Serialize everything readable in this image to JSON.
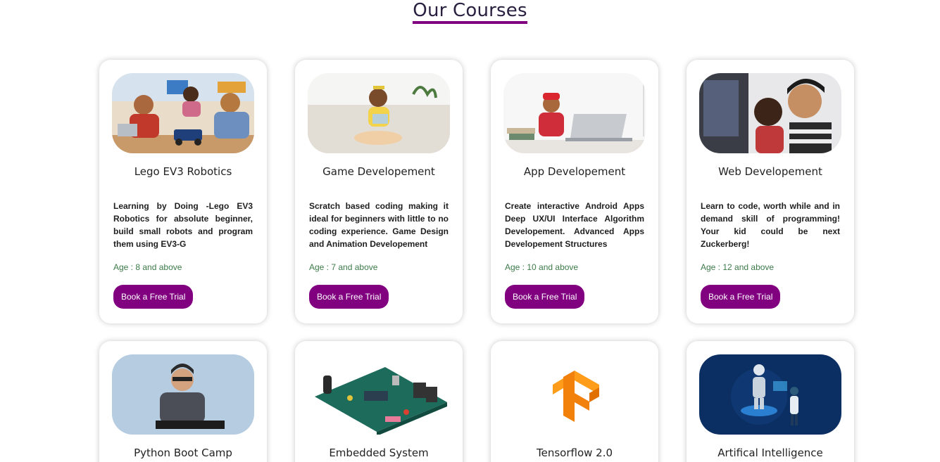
{
  "section_title": "Our Courses",
  "colors": {
    "accent": "#800080",
    "age_text": "#3d7a4a"
  },
  "courses": [
    {
      "title": "Lego EV3 Robotics",
      "description": "Learning by Doing -Lego EV3 Robotics for absolute beginner, build small robots and program them using EV3-G",
      "age": "Age : 8 and above",
      "button": "Book a Free Trial"
    },
    {
      "title": "Game Developement",
      "description": "Scratch based coding making it ideal for beginners with little to no coding experience. Game Design and Animation Developement",
      "age": "Age : 7 and above",
      "button": "Book a Free Trial"
    },
    {
      "title": "App Developement",
      "description": "Create interactive Android Apps Deep UX/UI Interface Algorithm Developement. Advanced Apps Developement Structures",
      "age": "Age : 10 and above",
      "button": "Book a Free Trial"
    },
    {
      "title": "Web Developement",
      "description": "Learn to code, worth while and in demand skill of programming! Your kid could be next Zuckerberg!",
      "age": "Age : 12 and above",
      "button": "Book a Free Trial"
    },
    {
      "title": "Python Boot Camp"
    },
    {
      "title": "Embedded System"
    },
    {
      "title": "Tensorflow 2.0"
    },
    {
      "title": "Artifical Intelligence"
    }
  ]
}
